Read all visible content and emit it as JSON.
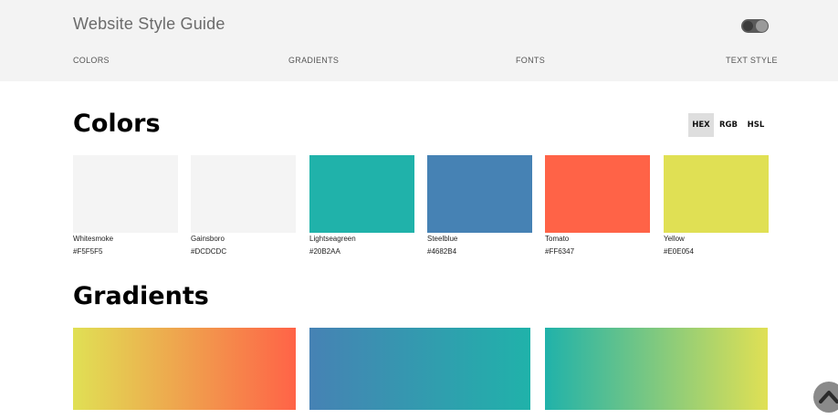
{
  "header": {
    "title": "Website Style Guide",
    "nav": [
      "COLORS",
      "GRADIENTS",
      "FONTS",
      "TEXT STYLE"
    ]
  },
  "colors_section": {
    "title": "Colors",
    "formats": [
      "HEX",
      "RGB",
      "HSL"
    ],
    "active_format": "HEX",
    "swatches": [
      {
        "name": "Whitesmoke",
        "hex": "#F5F5F5",
        "color": "#f4f4f4"
      },
      {
        "name": "Gainsboro",
        "hex": "#DCDCDC",
        "color": "#f4f4f4"
      },
      {
        "name": "Lightseagreen",
        "hex": "#20B2AA",
        "color": "#20b2aa"
      },
      {
        "name": "Steelblue",
        "hex": "#4682B4",
        "color": "#4682b4"
      },
      {
        "name": "Tomato",
        "hex": "#FF6347",
        "color": "#ff6347"
      },
      {
        "name": "Yellow",
        "hex": "#E0E054",
        "color": "#e0e054"
      }
    ]
  },
  "gradients_section": {
    "title": "Gradients",
    "gradients": [
      {
        "from": "#e0e054",
        "to": "#ff6347"
      },
      {
        "from": "#4682b4",
        "to": "#20b2aa"
      },
      {
        "from": "#20b2aa",
        "to": "#e0e054"
      }
    ]
  },
  "icons": {
    "theme_toggle": "theme-toggle-icon",
    "scroll_top": "chevron-up-icon"
  }
}
